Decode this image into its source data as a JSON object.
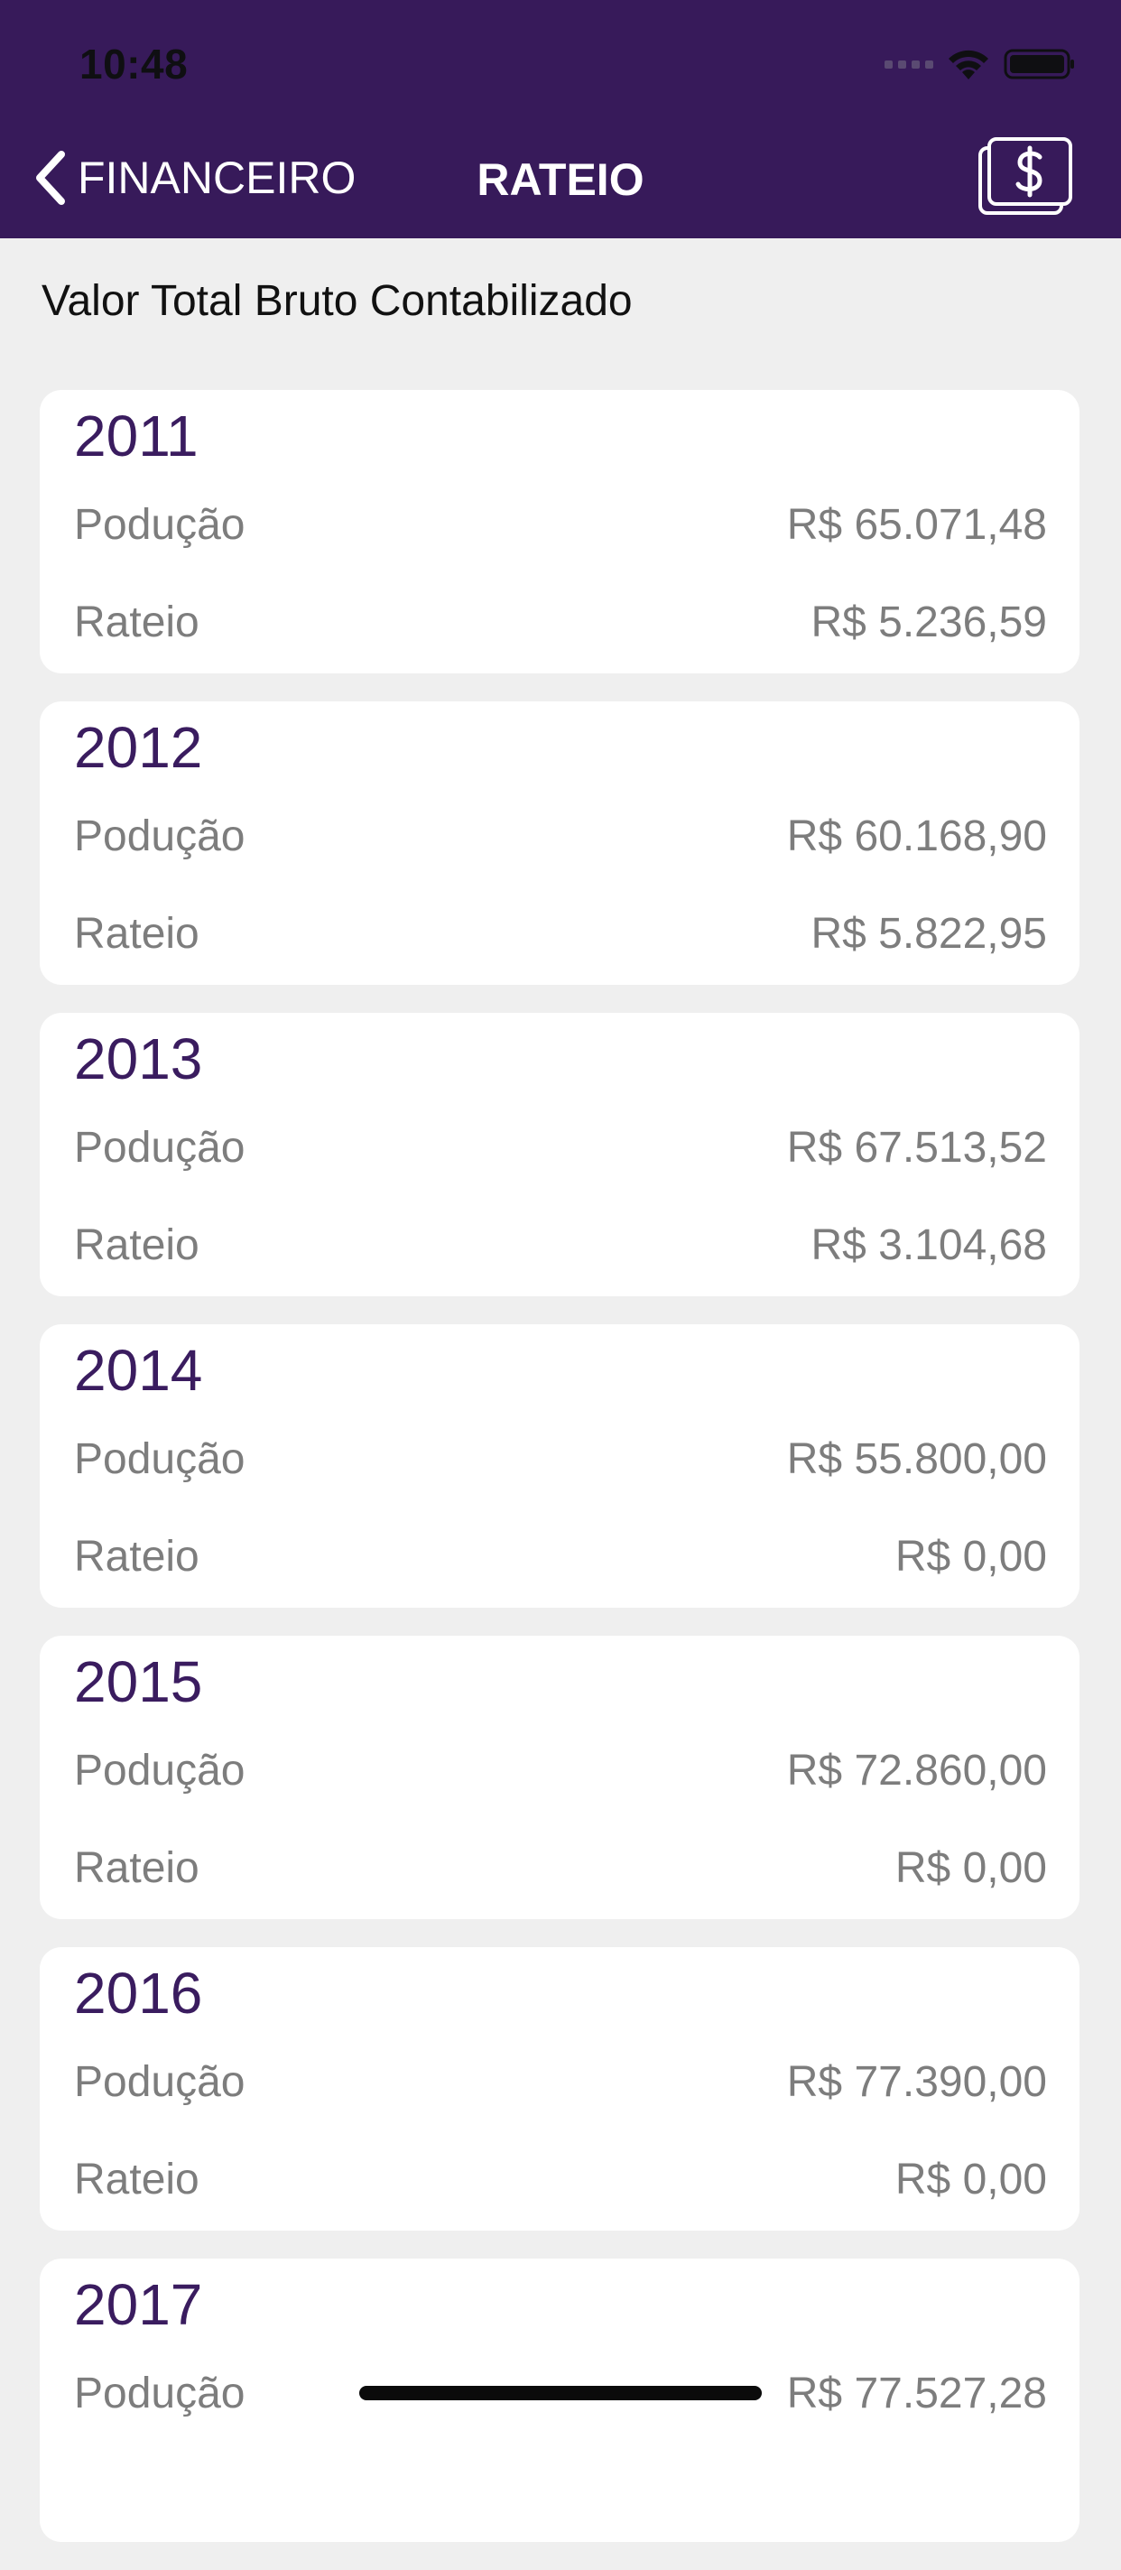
{
  "status_bar": {
    "time": "10:48",
    "icons": [
      "signal-icon",
      "wifi-icon",
      "battery-icon"
    ]
  },
  "navbar": {
    "back_label": "FINANCEIRO",
    "title": "RATEIO",
    "right_icon": "money-bill-icon"
  },
  "section_title": "Valor Total Bruto Contabilizado",
  "cards": [
    {
      "year": "2011",
      "prod_label": "Podução",
      "prod_value": "R$ 65.071,48",
      "rateio_label": "Rateio",
      "rateio_value": "R$ 5.236,59"
    },
    {
      "year": "2012",
      "prod_label": "Podução",
      "prod_value": "R$ 60.168,90",
      "rateio_label": "Rateio",
      "rateio_value": "R$ 5.822,95"
    },
    {
      "year": "2013",
      "prod_label": "Podução",
      "prod_value": "R$ 67.513,52",
      "rateio_label": "Rateio",
      "rateio_value": "R$ 3.104,68"
    },
    {
      "year": "2014",
      "prod_label": "Podução",
      "prod_value": "R$ 55.800,00",
      "rateio_label": "Rateio",
      "rateio_value": "R$ 0,00"
    },
    {
      "year": "2015",
      "prod_label": "Podução",
      "prod_value": "R$ 72.860,00",
      "rateio_label": "Rateio",
      "rateio_value": "R$ 0,00"
    },
    {
      "year": "2016",
      "prod_label": "Podução",
      "prod_value": "R$ 77.390,00",
      "rateio_label": "Rateio",
      "rateio_value": "R$ 0,00"
    },
    {
      "year": "2017",
      "prod_label": "Podução",
      "prod_value": "R$ 77.527,28"
    }
  ],
  "colors": {
    "header_bg": "#371a5a",
    "year_text": "#3a1c5f",
    "row_text": "#7d7d7d",
    "page_bg": "#efefef"
  }
}
